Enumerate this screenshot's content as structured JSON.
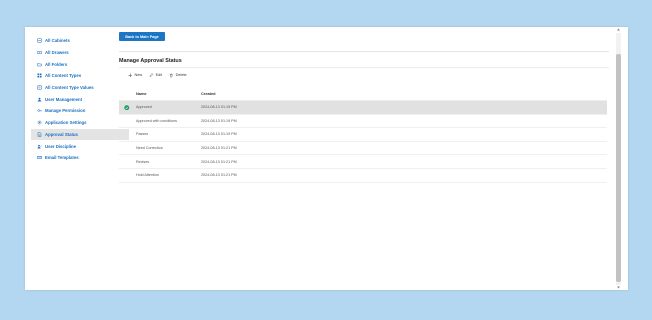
{
  "sidebar": {
    "items": [
      {
        "label": "All Cabinets",
        "icon": "cabinet-icon"
      },
      {
        "label": "All Drawers",
        "icon": "drawer-icon"
      },
      {
        "label": "All Folders",
        "icon": "folder-icon"
      },
      {
        "label": "All Content Types",
        "icon": "grid-icon"
      },
      {
        "label": "All Content Type Values",
        "icon": "list-icon"
      },
      {
        "label": "User Management",
        "icon": "user-icon"
      },
      {
        "label": "Manage Permission",
        "icon": "key-icon"
      },
      {
        "label": "Application Settings",
        "icon": "gear-icon"
      },
      {
        "label": "Approval Status",
        "icon": "document-icon"
      },
      {
        "label": "User Discipline",
        "icon": "user-check-icon"
      },
      {
        "label": "Email Templates",
        "icon": "mail-icon"
      }
    ],
    "active_index": 8
  },
  "header": {
    "back_label": "Back to Main Page"
  },
  "page": {
    "title": "Manage Approval Status"
  },
  "toolbar": {
    "new_label": "New",
    "edit_label": "Edit",
    "delete_label": "Delete"
  },
  "table": {
    "headers": {
      "name": "Name",
      "created": "Created"
    },
    "rows": [
      {
        "name": "Approved",
        "created": "2024-08-13 01:19 PM",
        "selected": true
      },
      {
        "name": "Approved with conditions",
        "created": "2024-08-13 01:19 PM",
        "selected": false
      },
      {
        "name": "Passes",
        "created": "2024-08-13 01:19 PM",
        "selected": false
      },
      {
        "name": "Need Correction",
        "created": "2024-08-13 01:21 PM",
        "selected": false
      },
      {
        "name": "Revises",
        "created": "2024-08-13 01:21 PM",
        "selected": false
      },
      {
        "name": "Hold Attention",
        "created": "2024-08-13 01:21 PM",
        "selected": false
      }
    ]
  },
  "colors": {
    "accent": "#1d76c4",
    "link": "#1a6fbf",
    "background": "#b3d7f0",
    "success": "#1a9d61"
  }
}
